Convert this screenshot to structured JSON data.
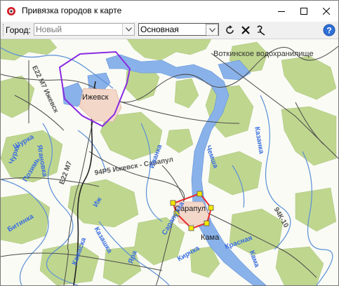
{
  "window": {
    "title": "Привязка городов к карте",
    "app_icon": "red-ring-icon",
    "controls": {
      "minimize": "minimize-icon",
      "maximize": "maximize-icon",
      "close": "close-icon"
    }
  },
  "toolbar": {
    "city_label": "Город:",
    "city_placeholder": "Новый",
    "city_value": "",
    "layer_value": "Основная",
    "buttons": [
      {
        "name": "undo-button",
        "icon": "undo-icon"
      },
      {
        "name": "delete-button",
        "icon": "cross-icon"
      },
      {
        "name": "pick-button",
        "icon": "binding-icon"
      }
    ],
    "help_icon": "help-icon"
  },
  "map": {
    "labels": {
      "reservoir": "Воткинское водохранилище",
      "city_izhevsk": "Ижевск",
      "city_sarapul": "Сарапул",
      "city_kama": "Кама",
      "road_e22": "E22 M7 Ижевск",
      "road_m7": "E22 M7",
      "road_94p": "94Р5 Ижевск - Сарапул",
      "road_ost": "94К-10",
      "river_izh": "Иж",
      "river_kama": "Кама",
      "river_chur": "Чурка",
      "river_shur": "Шурка",
      "river_ivan": "Иванка",
      "river_yagan": "Ягановка",
      "river_pozim": "Позимь",
      "river_yarnaya": "Яра",
      "river_bitinka": "Битинка",
      "river_krasnaya": "Красная",
      "river_kazanka": "Казанка",
      "river_kirgil": "Кирчка",
      "river_chemsha": "Чемша",
      "river_kazmaska": "Камаска",
      "river_kaz": "Казашка",
      "river_sarapulka": "Сарапулка"
    },
    "colors": {
      "forest": "#bfd68f",
      "water": "#7fa9e4",
      "road": "#505050",
      "izhevsk_polygon": "#8a2be2",
      "sarapul_polygon": "#e8282a",
      "vertex": "#f5e600"
    }
  }
}
